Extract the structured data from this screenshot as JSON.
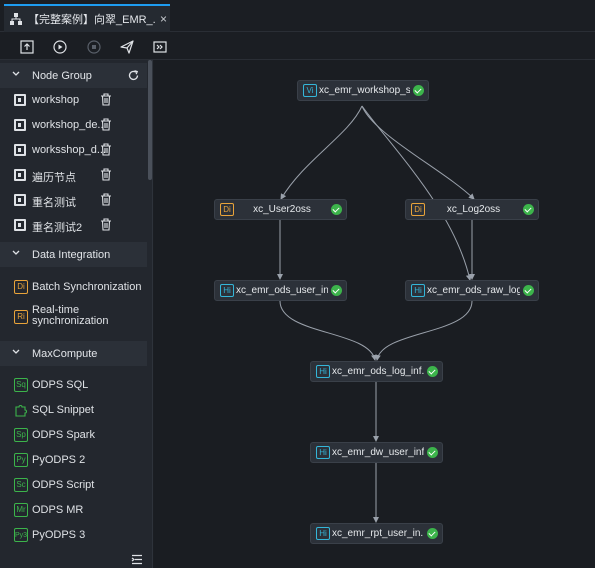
{
  "tab": {
    "title": "【完整案例】向翠_EMR_...",
    "close": "×"
  },
  "toolbar": {
    "buttons": [
      {
        "icon": "submit-icon"
      },
      {
        "icon": "run-icon"
      },
      {
        "icon": "stop-icon"
      },
      {
        "icon": "publish-icon"
      },
      {
        "icon": "goto-ops-icon"
      }
    ]
  },
  "sidebar": {
    "node_group": {
      "title": "Node Group",
      "items": [
        {
          "label": "workshop"
        },
        {
          "label": "workshop_de..."
        },
        {
          "label": "worksshop_d..."
        },
        {
          "label": "遍历节点"
        },
        {
          "label": "重名测试"
        },
        {
          "label": "重名测试2"
        }
      ]
    },
    "data_integration": {
      "title": "Data Integration",
      "items": [
        {
          "badge": "Di",
          "label": "Batch Synchronization"
        },
        {
          "badge": "Ri",
          "label": "Real-time synchronization"
        }
      ]
    },
    "maxcompute": {
      "title": "MaxCompute",
      "items": [
        {
          "badge": "Sq",
          "label": "ODPS SQL"
        },
        {
          "badge": "",
          "label": "SQL Snippet"
        },
        {
          "badge": "Sp",
          "label": "ODPS Spark"
        },
        {
          "badge": "Py",
          "label": "PyODPS 2"
        },
        {
          "badge": "Sc",
          "label": "ODPS Script"
        },
        {
          "badge": "Mr",
          "label": "ODPS MR"
        },
        {
          "badge": "Py3",
          "label": "PyODPS 3"
        }
      ]
    }
  },
  "canvas": {
    "nodes": [
      {
        "badge": "Vi",
        "label": "xc_emr_workshop_st...",
        "status": "success"
      },
      {
        "badge": "Di",
        "label": "xc_User2oss",
        "status": "success"
      },
      {
        "badge": "Di",
        "label": "xc_Log2oss",
        "status": "success"
      },
      {
        "badge": "Hi",
        "label": "xc_emr_ods_user_in...",
        "status": "success"
      },
      {
        "badge": "Hi",
        "label": "xc_emr_ods_raw_log...",
        "status": "success"
      },
      {
        "badge": "Hi",
        "label": "xc_emr_ods_log_inf...",
        "status": "success"
      },
      {
        "badge": "Hi",
        "label": "xc_emr_dw_user_inf...",
        "status": "success"
      },
      {
        "badge": "Hi",
        "label": "xc_emr_rpt_user_in...",
        "status": "success"
      }
    ]
  },
  "colors": {
    "accent": "#1e9cf0",
    "success": "#3cb44b",
    "di_badge": "#e8a33a",
    "hi_badge": "#34b6d9",
    "canvas_bg": "#1a1d22",
    "sidebar_bg": "#23272e"
  }
}
